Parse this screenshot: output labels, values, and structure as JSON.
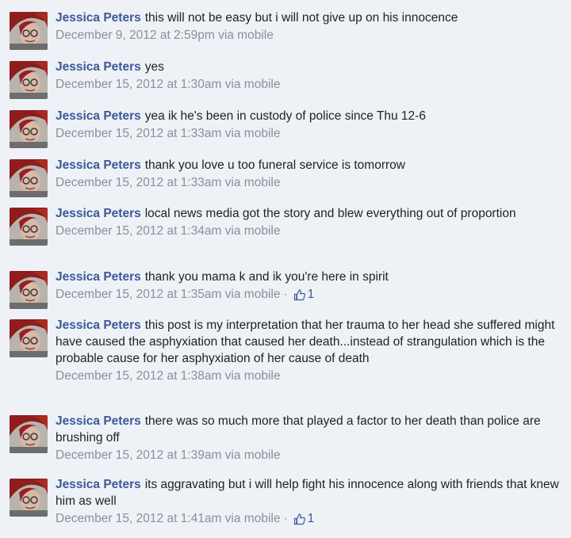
{
  "comments": [
    {
      "author": "Jessica Peters",
      "text": "this will not be easy but i will not give up on his innocence",
      "timestamp": "December 9, 2012 at 2:59pm via mobile"
    },
    {
      "author": "Jessica Peters",
      "text": "yes",
      "timestamp": "December 15, 2012 at 1:30am via mobile"
    },
    {
      "author": "Jessica Peters",
      "text": "yea ik he's been in custody of police since Thu 12-6",
      "timestamp": "December 15, 2012 at 1:33am via mobile"
    },
    {
      "author": "Jessica Peters",
      "text": "thank you love u too funeral service is tomorrow",
      "timestamp": "December 15, 2012 at 1:33am via mobile"
    },
    {
      "author": "Jessica Peters",
      "text": "local news media got the story and blew everything out of proportion",
      "timestamp": "December 15, 2012 at 1:34am via mobile"
    },
    {
      "author": "Jessica Peters",
      "text": "thank you mama k and ik you're here in spirit",
      "timestamp": "December 15, 2012 at 1:35am via mobile",
      "likes": "1"
    },
    {
      "author": "Jessica Peters",
      "text": "this post is my interpretation that her trauma to her head she suffered might have caused the asphyxiation that caused her death...instead of strangulation which is the probable cause for her asphyxiation of her cause of death",
      "timestamp": "December 15, 2012 at 1:38am via mobile"
    },
    {
      "author": "Jessica Peters",
      "text": "there was so much more that played a factor to her death than police are brushing off",
      "timestamp": "December 15, 2012 at 1:39am via mobile"
    },
    {
      "author": "Jessica Peters",
      "text": "its aggravating but i will help fight his innocence along with friends that knew him as well",
      "timestamp": "December 15, 2012 at 1:41am via mobile",
      "likes": "1"
    }
  ],
  "separator": "·",
  "icons": {
    "avatar": "profile-photo",
    "like": "thumbs-up-icon"
  },
  "colors": {
    "author": "#3b5998",
    "meta": "#8a8f99",
    "background": "#eef1f6"
  }
}
